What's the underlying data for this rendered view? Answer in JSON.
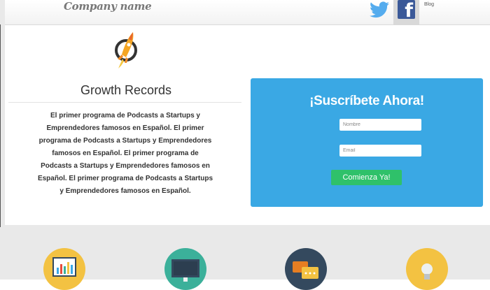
{
  "header": {
    "company_name": "Company name",
    "blog_label": "Blog",
    "facebook_letter": "f"
  },
  "hero": {
    "title": "Growth Records",
    "description": "El primer programa de Podcasts a Startups y Emprendedores famosos en Español. El primer programa de Podcasts a Startups y Emprendedores famosos en Español. El primer programa de Podcasts a Startups y Emprendedores famosos en Español. El primer programa de Podcasts a Startups y Emprendedores famosos en Español."
  },
  "signup": {
    "title": "¡Suscríbete Ahora!",
    "name_placeholder": "Nombre",
    "email_placeholder": "Email",
    "button_label": "Comienza Ya!"
  },
  "features": [
    {
      "icon": "chart-board-icon",
      "color": "#f3c242"
    },
    {
      "icon": "monitor-icon",
      "color": "#3bb09a"
    },
    {
      "icon": "chat-bubbles-icon",
      "color": "#34495e"
    },
    {
      "icon": "lightbulb-icon",
      "color": "#f3c242"
    }
  ],
  "colors": {
    "signup_bg": "#3aa8e4",
    "button_bg": "#2fc16a",
    "twitter": "#55acee",
    "facebook": "#3b5998"
  }
}
